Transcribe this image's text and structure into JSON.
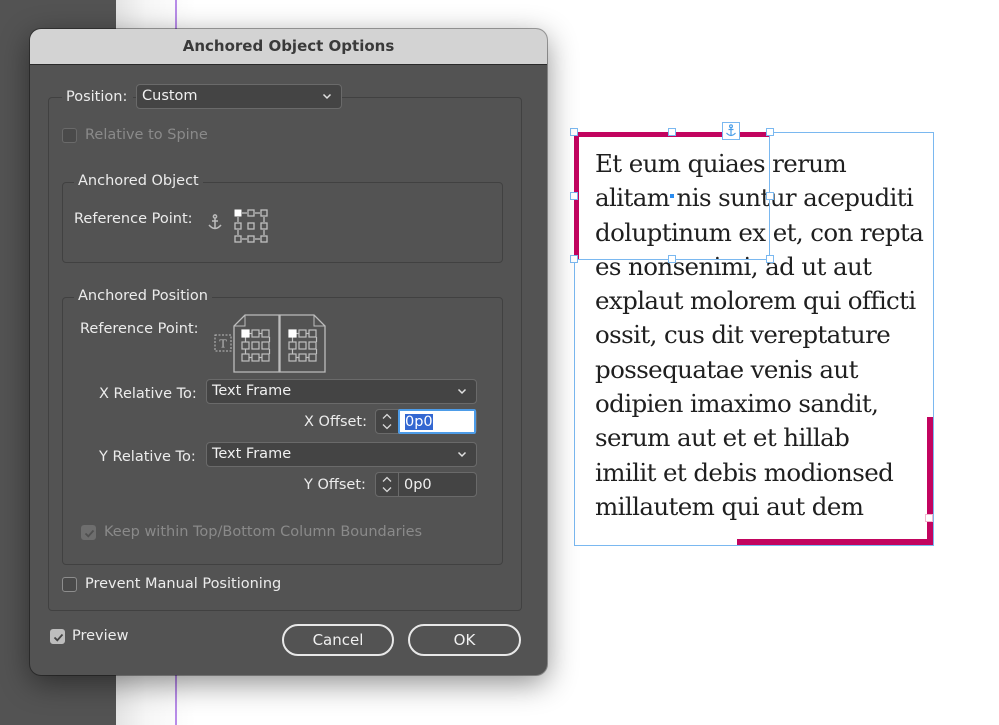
{
  "dialog": {
    "title": "Anchored Object Options",
    "position": {
      "label": "Position:",
      "value": "Custom"
    },
    "relative_to_spine": {
      "label": "Relative to Spine",
      "checked": false,
      "enabled": false
    },
    "anchored_object": {
      "legend": "Anchored Object",
      "reference_point_label": "Reference Point:",
      "selected_point": "top-left"
    },
    "anchored_position": {
      "legend": "Anchored Position",
      "reference_point_label": "Reference Point:",
      "selected_point": "top-left",
      "x_relative_to": {
        "label": "X Relative To:",
        "value": "Text Frame"
      },
      "x_offset": {
        "label": "X Offset:",
        "value": "0p0"
      },
      "y_relative_to": {
        "label": "Y Relative To:",
        "value": "Text Frame"
      },
      "y_offset": {
        "label": "Y Offset:",
        "value": "0p0"
      },
      "keep_within": {
        "label": "Keep within Top/Bottom Column Boundaries",
        "checked": true,
        "enabled": false
      }
    },
    "prevent_manual": {
      "label": "Prevent Manual Positioning",
      "checked": false
    },
    "preview": {
      "label": "Preview",
      "checked": true
    },
    "buttons": {
      "cancel": "Cancel",
      "ok": "OK"
    }
  },
  "document": {
    "accent_color": "#c2045f",
    "selection_color": "#7ab8f0",
    "text_lines": [
      "Et eum quiaes rerum",
      "alitam nis suntur acepuditi",
      "doluptinum ex et, con repta",
      "es nonsenimi, ad ut aut",
      "explaut molorem qui officti",
      "ossit, cus dit vereptature",
      "possequatae venis aut",
      "odipien imaximo sandit,",
      "serum aut et et hillab",
      "imilit et debis modionsed",
      "millautem qui aut dem"
    ]
  }
}
